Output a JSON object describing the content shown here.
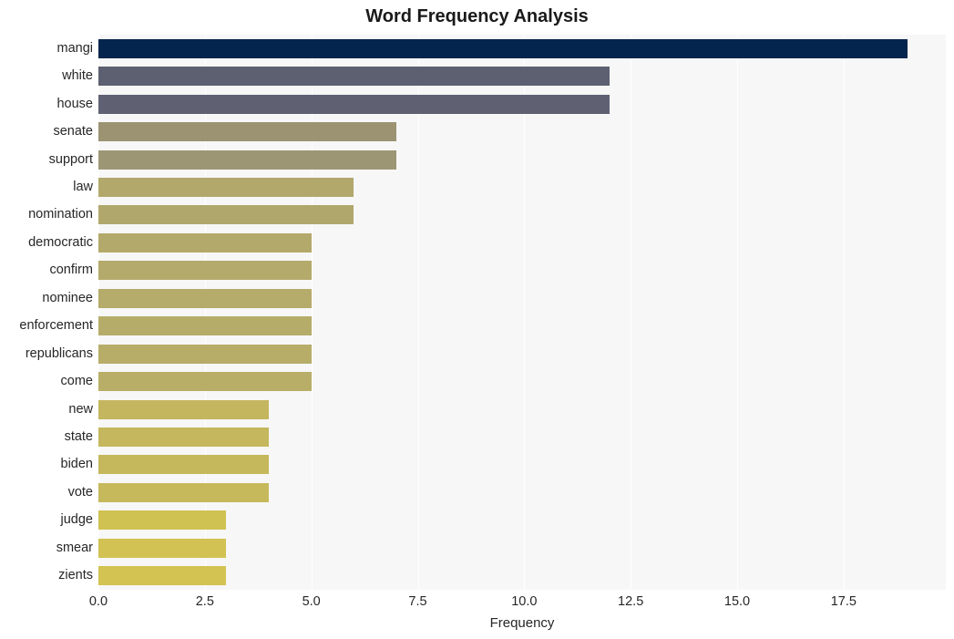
{
  "chart_data": {
    "type": "bar",
    "orientation": "horizontal",
    "title": "Word Frequency Analysis",
    "xlabel": "Frequency",
    "ylabel": "",
    "xlim": [
      0,
      19.9
    ],
    "xticks": [
      "0.0",
      "2.5",
      "5.0",
      "7.5",
      "10.0",
      "12.5",
      "15.0",
      "17.5"
    ],
    "xtick_values": [
      0,
      2.5,
      5,
      7.5,
      10,
      12.5,
      15,
      17.5
    ],
    "grid": true,
    "grid_axis": "x",
    "legend": "none",
    "categories": [
      "mangi",
      "white",
      "house",
      "senate",
      "support",
      "law",
      "nomination",
      "democratic",
      "confirm",
      "nominee",
      "enforcement",
      "republicans",
      "come",
      "new",
      "state",
      "biden",
      "vote",
      "judge",
      "smear",
      "zients"
    ],
    "values": [
      19,
      12,
      12,
      7,
      7,
      6,
      6,
      5,
      5,
      5,
      5,
      5,
      5,
      4,
      4,
      4,
      4,
      3,
      3,
      3
    ],
    "bar_colors": [
      "#04254e",
      "#5d6070",
      "#5f6173",
      "#9b9372",
      "#9d9674",
      "#b2a86c",
      "#b0a76c",
      "#b3a96a",
      "#b4aa6b",
      "#b5ab6a",
      "#b6ac69",
      "#b7ad69",
      "#b8ae68",
      "#c3b65e",
      "#c4b75d",
      "#c5b85c",
      "#c6b95b",
      "#d0c153",
      "#d1c253",
      "#d2c352"
    ],
    "plot_background": "#f7f7f7",
    "figure_background": "#ffffff",
    "gridline_color": "#ffffff",
    "text_color": "#262626",
    "title_color": "#1a1a1a"
  }
}
